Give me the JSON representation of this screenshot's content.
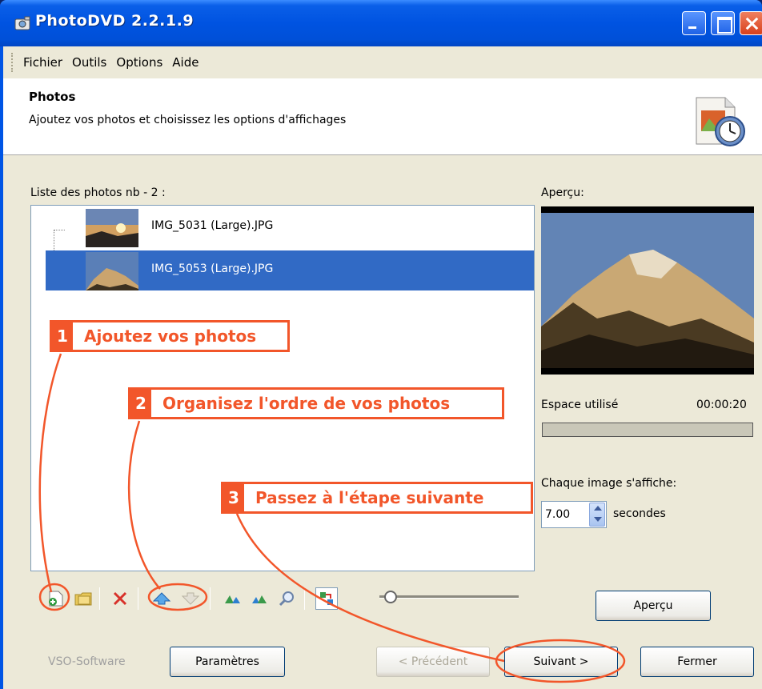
{
  "window": {
    "title": "PhotoDVD 2.2.1.9"
  },
  "menu": [
    "Fichier",
    "Outils",
    "Options",
    "Aide"
  ],
  "header": {
    "title": "Photos",
    "subtitle": "Ajoutez vos photos et choisissez les options d'affichages"
  },
  "list": {
    "label": "Liste des photos nb - 2 :",
    "items": [
      {
        "name": "IMG_5031 (Large).JPG",
        "selected": false
      },
      {
        "name": "IMG_5053 (Large).JPG",
        "selected": true
      }
    ]
  },
  "preview": {
    "label": "Aperçu:",
    "space_label": "Espace utilisé",
    "duration": "00:00:20",
    "space_used_fraction": 0,
    "display_label": "Chaque image s'affiche:",
    "seconds_value": "7.00",
    "seconds_unit": "secondes",
    "preview_button": "Aperçu"
  },
  "callouts": [
    {
      "num": "1",
      "text": "Ajoutez vos photos"
    },
    {
      "num": "2",
      "text": "Organisez l'ordre de vos photos"
    },
    {
      "num": "3",
      "text": "Passez à l'étape suivante"
    }
  ],
  "toolbar": {
    "icons": [
      "add-photo-icon",
      "add-folder-icon",
      "delete-icon",
      "move-up-icon",
      "move-down-icon",
      "rotate-left-icon",
      "rotate-right-icon",
      "zoom-icon",
      "sort-icon"
    ]
  },
  "footer": {
    "brand": "VSO-Software",
    "params_button": "Paramètres",
    "prev_button": "< Précédent",
    "next_button": "Suivant >",
    "close_button": "Fermer"
  },
  "colors": {
    "accent": "#f2562a",
    "selection": "#316ac5",
    "titlebar": "#0053e1"
  }
}
